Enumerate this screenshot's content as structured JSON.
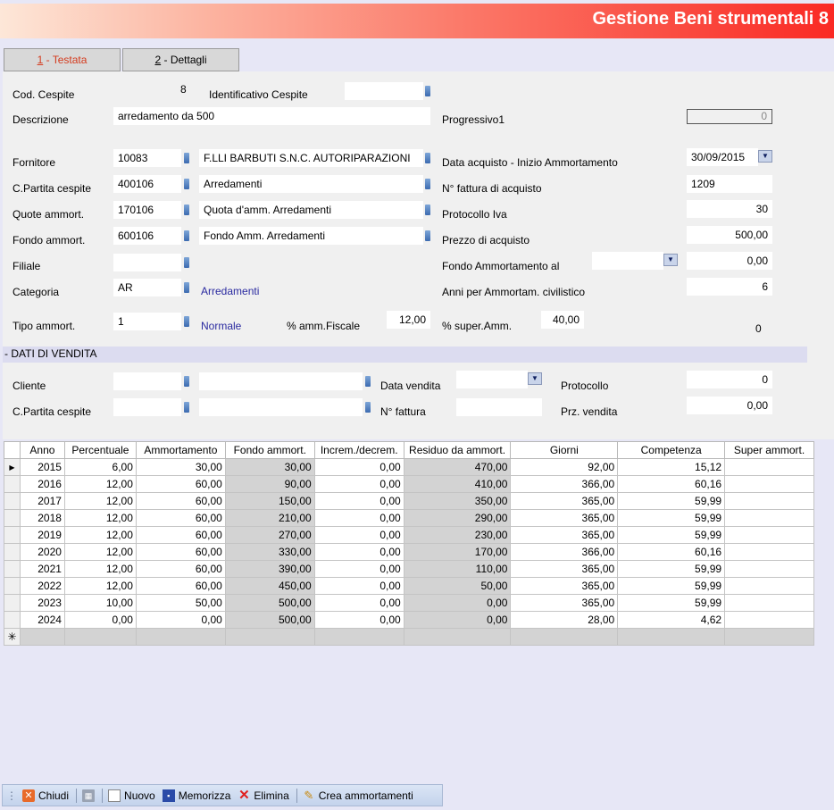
{
  "window": {
    "title": "Gestione Beni strumentali 8"
  },
  "tabs": [
    {
      "label": "1 - Testata",
      "underline": "1",
      "rest": " - Testata"
    },
    {
      "label": "2 - Dettagli",
      "underline": "2",
      "rest": " - Dettagli"
    }
  ],
  "form": {
    "cod_cespite": {
      "label": "Cod. Cespite",
      "value": "8"
    },
    "identificativo": {
      "label": "Identificativo Cespite",
      "value": ""
    },
    "descrizione": {
      "label": "Descrizione",
      "value": "arredamento da 500"
    },
    "progressivo": {
      "label": "Progressivo1",
      "value": "0"
    },
    "fornitore": {
      "label": "Fornitore",
      "code": "10083",
      "name": "F.LLI BARBUTI S.N.C. AUTORIPARAZIONI"
    },
    "data_acquisto": {
      "label": "Data acquisto - Inizio Ammortamento",
      "value": "30/09/2015"
    },
    "cpartita": {
      "label": "C.Partita cespite",
      "code": "400106",
      "name": "Arredamenti"
    },
    "nfattura_acq": {
      "label": "N° fattura di acquisto",
      "value": "1209"
    },
    "quote": {
      "label": "Quote ammort.",
      "code": "170106",
      "name": "Quota d'amm. Arredamenti"
    },
    "protocollo_iva": {
      "label": "Protocollo Iva",
      "value": "30"
    },
    "fondo": {
      "label": "Fondo ammort.",
      "code": "600106",
      "name": "Fondo Amm. Arredamenti"
    },
    "prezzo": {
      "label": "Prezzo di acquisto",
      "value": "500,00"
    },
    "filiale": {
      "label": "Filiale",
      "value": ""
    },
    "fondo_al": {
      "label": "Fondo Ammortamento al",
      "date": "",
      "value": "0,00"
    },
    "categoria": {
      "label": "Categoria",
      "code": "AR",
      "name": "Arredamenti"
    },
    "anni": {
      "label": "Anni per Ammortam. civilistico",
      "value": "6"
    },
    "tipo": {
      "label": "Tipo ammort.",
      "code": "1",
      "name": "Normale"
    },
    "amm_fiscale": {
      "label": "% amm.Fiscale",
      "value": "12,00"
    },
    "super_amm": {
      "label": "% super.Amm.",
      "value": "40,00"
    },
    "super_extra": "0"
  },
  "vendita": {
    "section": "- DATI DI VENDITA",
    "cliente": {
      "label": "Cliente",
      "code": "",
      "name": ""
    },
    "data_vendita": {
      "label": "Data vendita",
      "value": ""
    },
    "protocollo": {
      "label": "Protocollo",
      "value": "0"
    },
    "cpartita": {
      "label": "C.Partita cespite",
      "code": "",
      "name": ""
    },
    "nfattura": {
      "label": "N° fattura",
      "value": ""
    },
    "prz_vendita": {
      "label": "Prz. vendita",
      "value": "0,00"
    }
  },
  "grid": {
    "headers": [
      "Anno",
      "Percentuale",
      "Ammortamento",
      "Fondo ammort.",
      "Increm./decrem.",
      "Residuo da ammort.",
      "Giorni",
      "Competenza",
      "Super ammort."
    ],
    "rows": [
      [
        "2015",
        "6,00",
        "30,00",
        "30,00",
        "0,00",
        "470,00",
        "92,00",
        "15,12",
        ""
      ],
      [
        "2016",
        "12,00",
        "60,00",
        "90,00",
        "0,00",
        "410,00",
        "366,00",
        "60,16",
        ""
      ],
      [
        "2017",
        "12,00",
        "60,00",
        "150,00",
        "0,00",
        "350,00",
        "365,00",
        "59,99",
        ""
      ],
      [
        "2018",
        "12,00",
        "60,00",
        "210,00",
        "0,00",
        "290,00",
        "365,00",
        "59,99",
        ""
      ],
      [
        "2019",
        "12,00",
        "60,00",
        "270,00",
        "0,00",
        "230,00",
        "365,00",
        "59,99",
        ""
      ],
      [
        "2020",
        "12,00",
        "60,00",
        "330,00",
        "0,00",
        "170,00",
        "366,00",
        "60,16",
        ""
      ],
      [
        "2021",
        "12,00",
        "60,00",
        "390,00",
        "0,00",
        "110,00",
        "365,00",
        "59,99",
        ""
      ],
      [
        "2022",
        "12,00",
        "60,00",
        "450,00",
        "0,00",
        "50,00",
        "365,00",
        "59,99",
        ""
      ],
      [
        "2023",
        "10,00",
        "50,00",
        "500,00",
        "0,00",
        "0,00",
        "365,00",
        "59,99",
        ""
      ],
      [
        "2024",
        "0,00",
        "0,00",
        "500,00",
        "0,00",
        "0,00",
        "28,00",
        "4,62",
        ""
      ]
    ]
  },
  "toolbar": {
    "chiudi": "Chiudi",
    "nuovo": "Nuovo",
    "memorizza": "Memorizza",
    "elimina": "Elimina",
    "crea": "Crea ammortamenti"
  }
}
